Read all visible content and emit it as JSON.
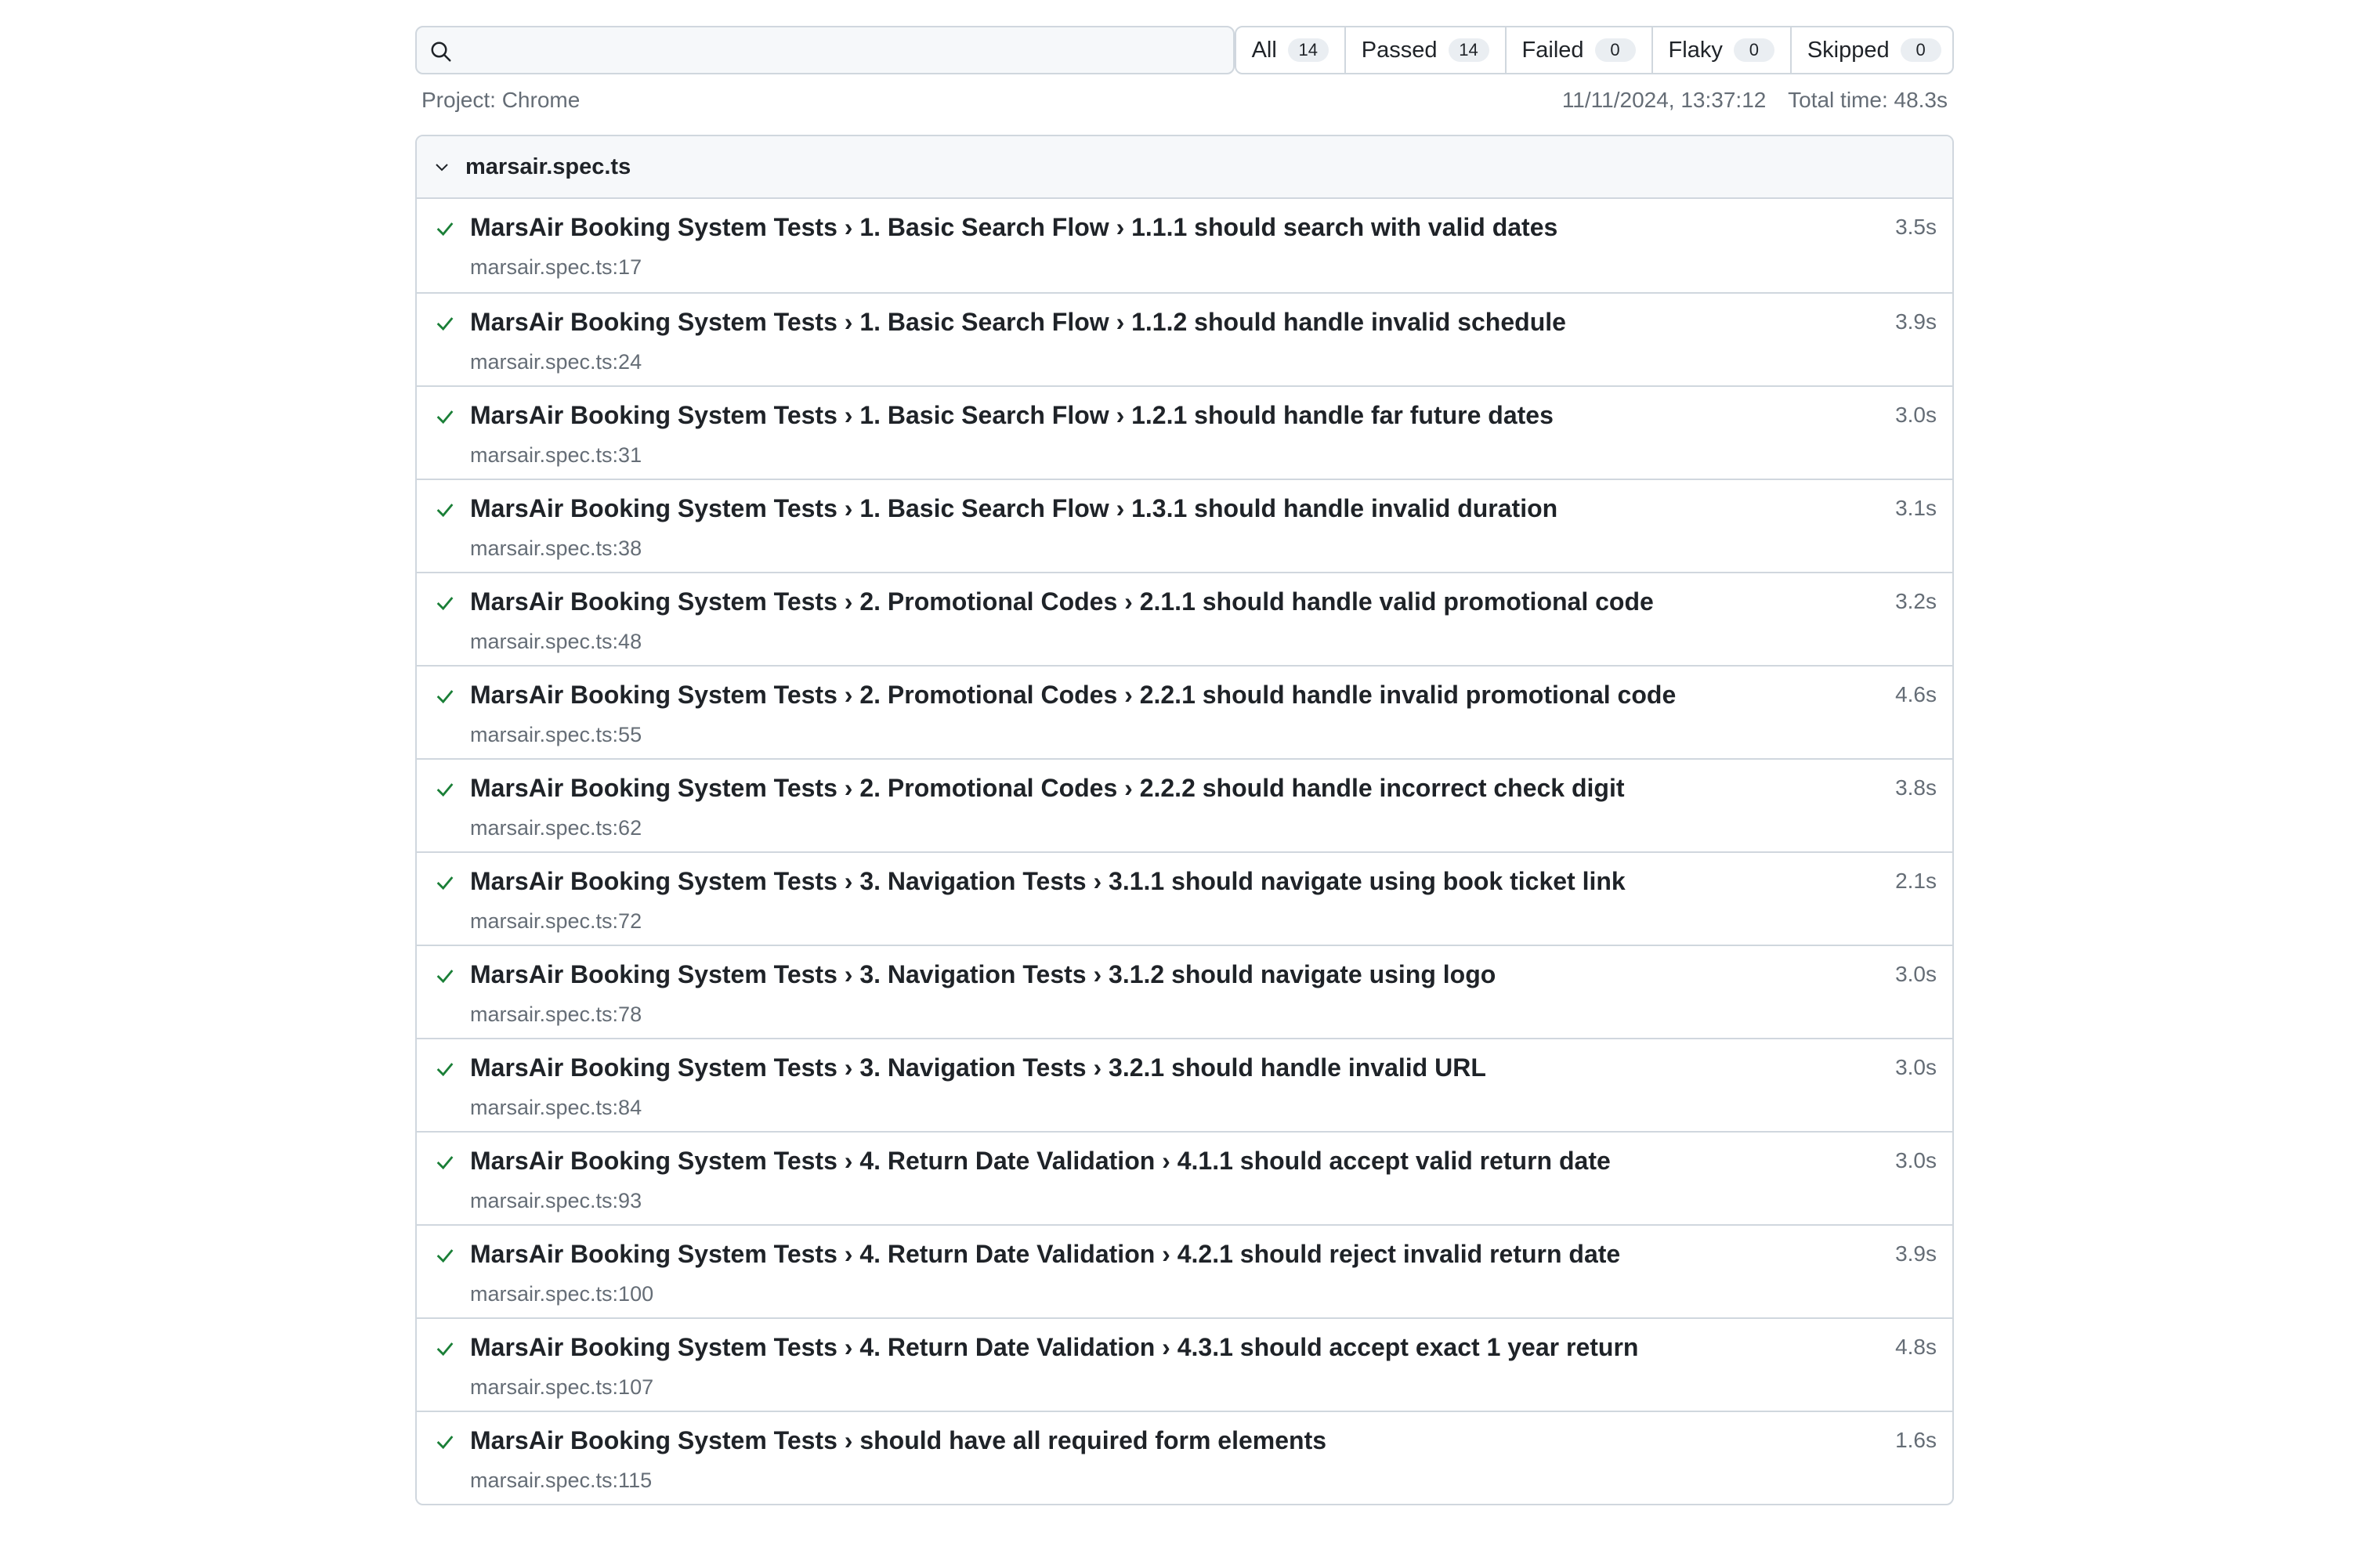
{
  "search": {
    "value": "",
    "placeholder": ""
  },
  "filters": [
    {
      "label": "All",
      "count": "14"
    },
    {
      "label": "Passed",
      "count": "14"
    },
    {
      "label": "Failed",
      "count": "0"
    },
    {
      "label": "Flaky",
      "count": "0"
    },
    {
      "label": "Skipped",
      "count": "0"
    }
  ],
  "meta": {
    "project": "Project: Chrome",
    "timestamp": "11/11/2024, 13:37:12",
    "total_time": "Total time: 48.3s"
  },
  "file": {
    "name": "marsair.spec.ts",
    "tests": [
      {
        "title": "MarsAir Booking System Tests › 1. Basic Search Flow › 1.1.1 should search with valid dates",
        "location": "marsair.spec.ts:17",
        "duration": "3.5s",
        "status": "passed"
      },
      {
        "title": "MarsAir Booking System Tests › 1. Basic Search Flow › 1.1.2 should handle invalid schedule",
        "location": "marsair.spec.ts:24",
        "duration": "3.9s",
        "status": "passed"
      },
      {
        "title": "MarsAir Booking System Tests › 1. Basic Search Flow › 1.2.1 should handle far future dates",
        "location": "marsair.spec.ts:31",
        "duration": "3.0s",
        "status": "passed"
      },
      {
        "title": "MarsAir Booking System Tests › 1. Basic Search Flow › 1.3.1 should handle invalid duration",
        "location": "marsair.spec.ts:38",
        "duration": "3.1s",
        "status": "passed"
      },
      {
        "title": "MarsAir Booking System Tests › 2. Promotional Codes › 2.1.1 should handle valid promotional code",
        "location": "marsair.spec.ts:48",
        "duration": "3.2s",
        "status": "passed"
      },
      {
        "title": "MarsAir Booking System Tests › 2. Promotional Codes › 2.2.1 should handle invalid promotional code",
        "location": "marsair.spec.ts:55",
        "duration": "4.6s",
        "status": "passed"
      },
      {
        "title": "MarsAir Booking System Tests › 2. Promotional Codes › 2.2.2 should handle incorrect check digit",
        "location": "marsair.spec.ts:62",
        "duration": "3.8s",
        "status": "passed"
      },
      {
        "title": "MarsAir Booking System Tests › 3. Navigation Tests › 3.1.1 should navigate using book ticket link",
        "location": "marsair.spec.ts:72",
        "duration": "2.1s",
        "status": "passed"
      },
      {
        "title": "MarsAir Booking System Tests › 3. Navigation Tests › 3.1.2 should navigate using logo",
        "location": "marsair.spec.ts:78",
        "duration": "3.0s",
        "status": "passed"
      },
      {
        "title": "MarsAir Booking System Tests › 3. Navigation Tests › 3.2.1 should handle invalid URL",
        "location": "marsair.spec.ts:84",
        "duration": "3.0s",
        "status": "passed"
      },
      {
        "title": "MarsAir Booking System Tests › 4. Return Date Validation › 4.1.1 should accept valid return date",
        "location": "marsair.spec.ts:93",
        "duration": "3.0s",
        "status": "passed"
      },
      {
        "title": "MarsAir Booking System Tests › 4. Return Date Validation › 4.2.1 should reject invalid return date",
        "location": "marsair.spec.ts:100",
        "duration": "3.9s",
        "status": "passed"
      },
      {
        "title": "MarsAir Booking System Tests › 4. Return Date Validation › 4.3.1 should accept exact 1 year return",
        "location": "marsair.spec.ts:107",
        "duration": "4.8s",
        "status": "passed"
      },
      {
        "title": "MarsAir Booking System Tests › should have all required form elements",
        "location": "marsair.spec.ts:115",
        "duration": "1.6s",
        "status": "passed"
      }
    ]
  },
  "colors": {
    "pass": "#1a7f37",
    "border": "#d0d7de",
    "muted": "#656d76"
  },
  "icons": {
    "search": "search-icon",
    "expand": "chevron-down-icon",
    "status": "check-icon"
  }
}
